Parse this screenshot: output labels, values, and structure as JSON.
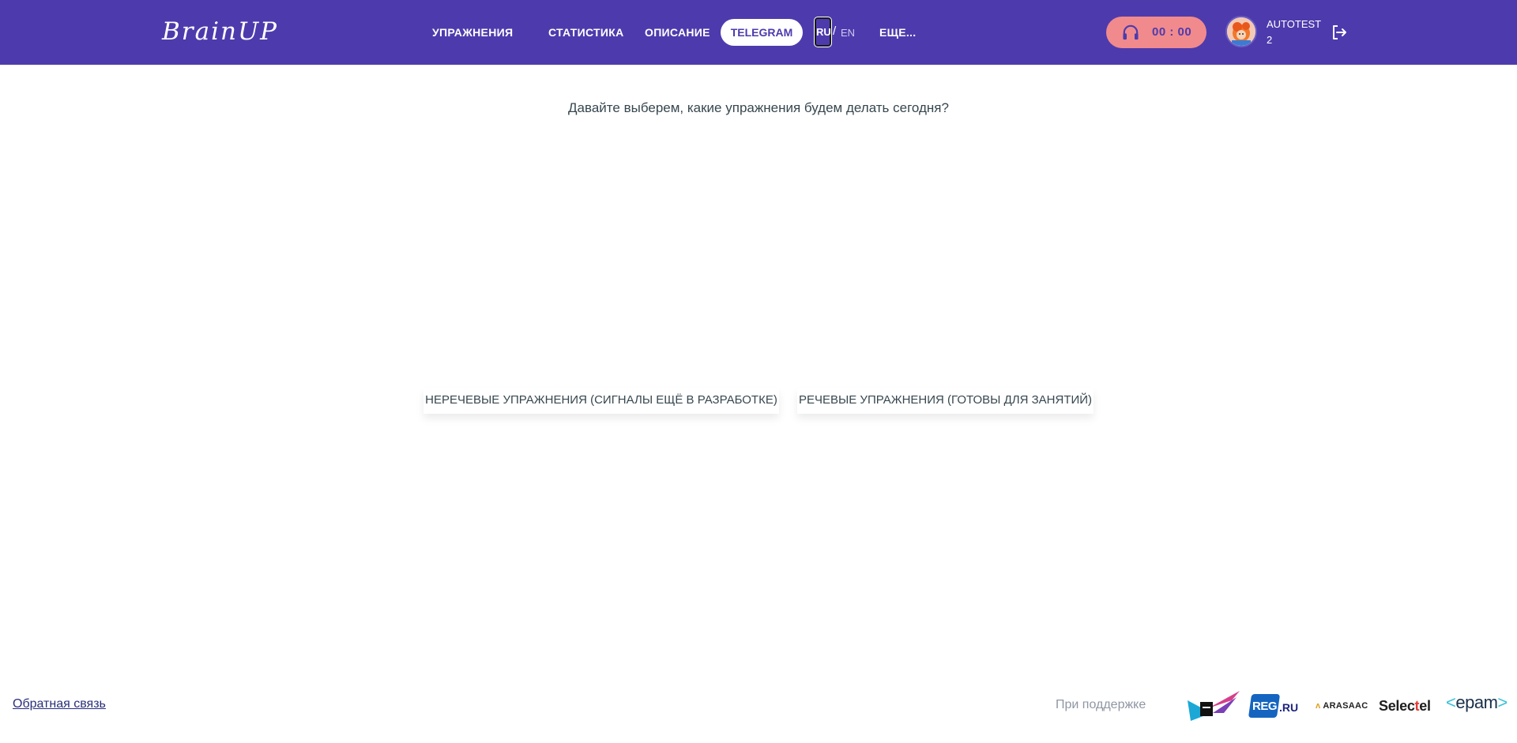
{
  "header": {
    "logo": "BrainUP",
    "nav": {
      "exercises": "УПРАЖНЕНИЯ",
      "statistics": "СТАТИСТИКА",
      "description": "ОПИСАНИЕ",
      "telegram": "TELEGRAM",
      "more": "ЕЩЕ..."
    },
    "lang": {
      "ru": "RU",
      "separator": "/",
      "en": "EN"
    },
    "timer": {
      "icon": "headphones-icon",
      "value": "00 : 00"
    },
    "user": {
      "name": "AUTOTEST",
      "number": "2",
      "avatar": "avatar-icon"
    },
    "logout_icon": "logout-icon"
  },
  "main": {
    "prompt": "Давайте выберем, какие упражнения будем делать сегодня?",
    "groups": [
      {
        "label": "НЕРЕЧЕВЫЕ УПРАЖНЕНИЯ (СИГНАЛЫ ЕЩЁ В РАЗРАБОТКЕ)"
      },
      {
        "label": "РЕЧЕВЫЕ УПРАЖНЕНИЯ (ГОТОВЫ ДЛЯ ЗАНЯТИЙ)"
      }
    ]
  },
  "footer": {
    "feedback": "Обратная связь",
    "support": "При поддержке",
    "partners": {
      "reg_main": "REG",
      "reg_suffix": ".RU",
      "arasaac": "ARASAAC",
      "selectel_a": "Selec",
      "selectel_b": "t",
      "selectel_c": "el",
      "epam_open": "<",
      "epam_text": "epam",
      "epam_close": ">"
    }
  },
  "colors": {
    "header_bg": "#4d3bad",
    "timer_bg": "#f18a8d",
    "text": "#37474f"
  }
}
